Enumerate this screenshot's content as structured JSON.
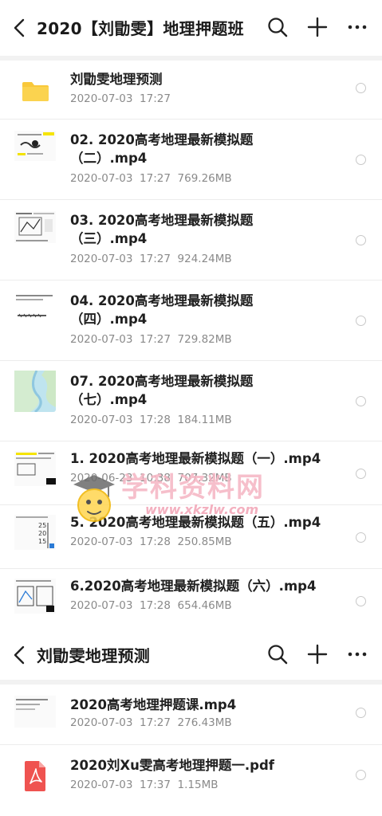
{
  "header1": {
    "title": "2020【刘勖雯】地理押题班"
  },
  "list1": [
    {
      "name": "刘勖雯地理预测",
      "meta": "2020-07-03  17:27",
      "kind": "folder"
    },
    {
      "name": "02. 2020高考地理最新模拟题\n（二）.mp4",
      "meta": "2020-07-03  17:27  769.26MB",
      "kind": "video"
    },
    {
      "name": "03. 2020高考地理最新模拟题\n（三）.mp4",
      "meta": "2020-07-03  17:27  924.24MB",
      "kind": "video"
    },
    {
      "name": "04. 2020高考地理最新模拟题\n（四）.mp4",
      "meta": "2020-07-03  17:27  729.82MB",
      "kind": "video"
    },
    {
      "name": "07. 2020高考地理最新模拟题\n（七）.mp4",
      "meta": "2020-07-03  17:28  184.11MB",
      "kind": "video"
    },
    {
      "name": "1. 2020高考地理最新模拟题（一）.mp4",
      "meta": "2020-06-23  10:38  707.32MB",
      "kind": "video"
    },
    {
      "name": "5. 2020高考地理最新模拟题（五）.mp4",
      "meta": "2020-07-03  17:28  250.85MB",
      "kind": "video"
    },
    {
      "name": "6.2020高考地理最新模拟题（六）.mp4",
      "meta": "2020-07-03  17:28  654.46MB",
      "kind": "video"
    }
  ],
  "header2": {
    "title": "刘勖雯地理预测"
  },
  "list2": [
    {
      "name": "2020高考地理押题课.mp4",
      "meta": "2020-07-03  17:27  276.43MB",
      "kind": "video"
    },
    {
      "name": "2020刘Xu雯高考地理押题一.pdf",
      "meta": "2020-07-03  17:37  1.15MB",
      "kind": "pdf"
    }
  ],
  "watermark": {
    "text": "学科资料网",
    "url": "www.xkzlw.com"
  },
  "icons": {
    "back": "chevron-left-icon",
    "search": "search-icon",
    "add": "plus-icon",
    "more": "more-horizontal-icon",
    "folder": "folder-icon",
    "pdf": "pdf-icon"
  },
  "colors": {
    "folder": "#f9c83a",
    "pdf": "#ef5350",
    "divider": "#ececec"
  }
}
